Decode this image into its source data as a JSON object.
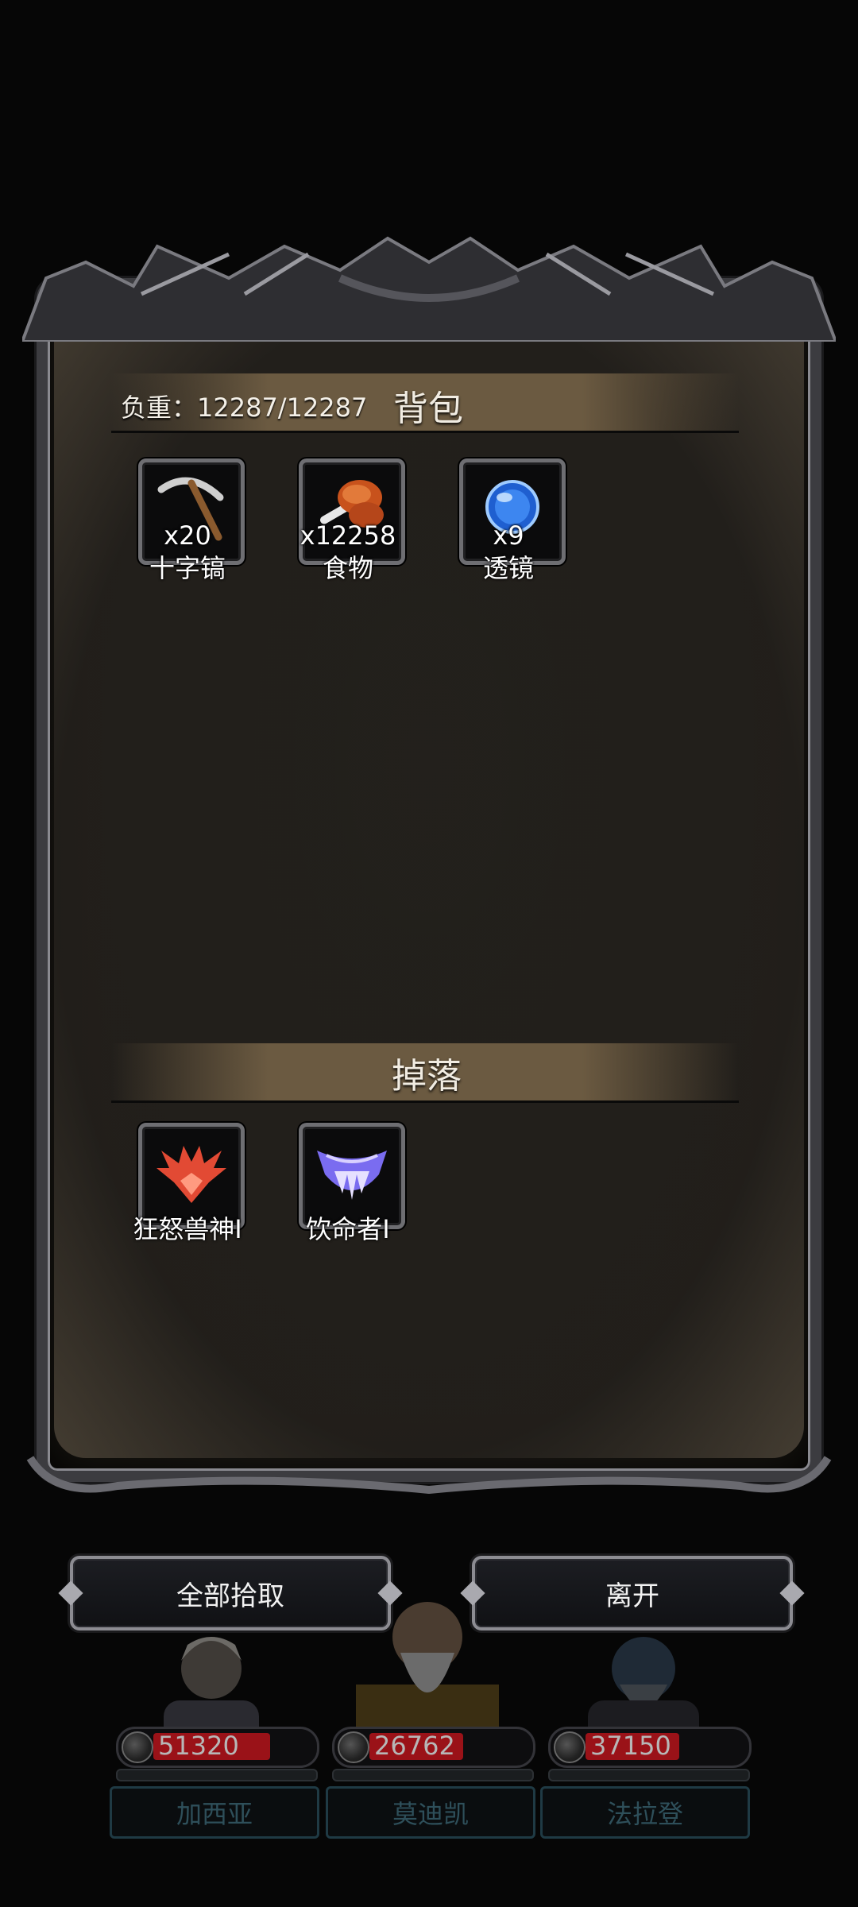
{
  "bag": {
    "title": "背包",
    "weight_label": "负重：12287/12287",
    "items": [
      {
        "name": "十字镐",
        "qty": "x20",
        "icon": "pickaxe-icon"
      },
      {
        "name": "食物",
        "qty": "x12258",
        "icon": "meat-icon"
      },
      {
        "name": "透镜",
        "qty": "x9",
        "icon": "lens-icon"
      }
    ]
  },
  "drop": {
    "title": "掉落",
    "items": [
      {
        "name": "狂怒兽神Ⅰ",
        "icon": "beast-crest-icon"
      },
      {
        "name": "饮命者Ⅰ",
        "icon": "fang-crest-icon"
      }
    ]
  },
  "actions": {
    "pick_all": "全部拾取",
    "leave": "离开"
  },
  "heroes": [
    {
      "name": "加西亚",
      "hp": "51320",
      "hp_fill": 0.75
    },
    {
      "name": "莫迪凯",
      "hp": "26762",
      "hp_fill": 0.6
    },
    {
      "name": "法拉登",
      "hp": "37150",
      "hp_fill": 0.6
    }
  ]
}
